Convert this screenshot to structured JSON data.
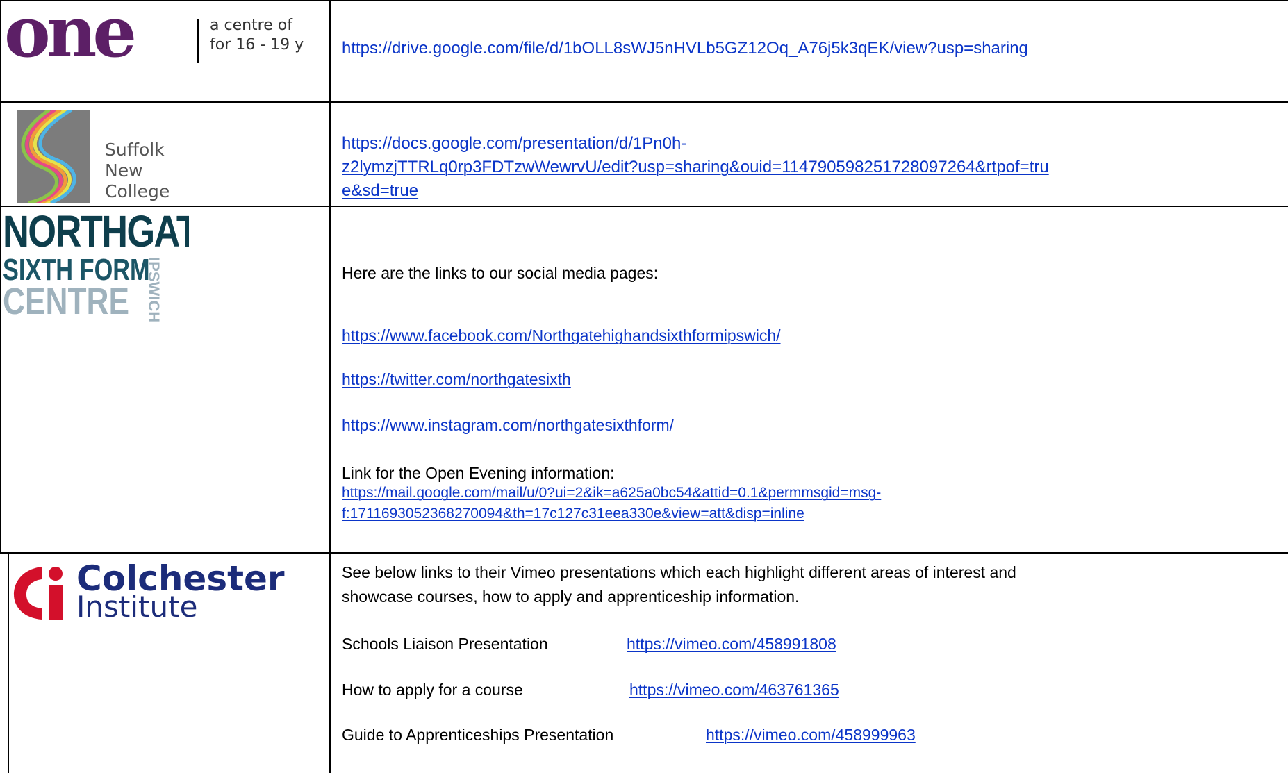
{
  "rows": [
    {
      "logo": {
        "name": "one",
        "wordmark": "one",
        "tagline_line1": "a centre of",
        "tagline_line2": "for 16 - 19 y",
        "color": "#5c1f66"
      },
      "url_lines": [
        "https://drive.google.com/file/d/1bOLL8sWJ5nHVLb5GZ12Oq_A76j5k3qEK/view?usp=sharing"
      ]
    },
    {
      "logo": {
        "name": "suffolk-new-college",
        "line1": "Suffolk",
        "line2": "New",
        "line3": "College"
      },
      "url_lines": [
        "https://docs.google.com/presentation/d/1Pn0h-",
        "z2lymzjTTRLq0rp3FDTzwWewrvU/edit?usp=sharing&ouid=114790598251728097264&rtpof=tru",
        "e&sd=true"
      ]
    },
    {
      "logo": {
        "name": "northgate-sixth-form-centre",
        "line1": "NORTHGATE",
        "line2": "SIXTH FORM",
        "line3": "CENTRE",
        "side": "IPSWICH",
        "color_dark": "#0e3e4c",
        "color_light": "#9fb2bd"
      },
      "intro": "Here are the links to our social media pages:",
      "social_links": [
        "https://www.facebook.com/Northgatehighandsixthformipswich/",
        "https://twitter.com/northgatesixth",
        "https://www.instagram.com/northgatesixthform/"
      ],
      "open_evening_label": "Link for the Open Evening information:",
      "open_evening_lines": [
        "https://mail.google.com/mail/u/0?ui=2&ik=a625a0bc54&attid=0.1&permmsgid=msg-",
        "f:1711693052368270094&th=17c127c31eea330e&view=att&disp=inline"
      ]
    },
    {
      "logo": {
        "name": "colchester-institute",
        "line1": "Colchester",
        "line2": "Institute",
        "red": "#d3102b",
        "blue": "#1c2c7a"
      },
      "intro_line1": "See below links to their Vimeo presentations which each highlight different areas of interest and",
      "intro_line2": "showcase courses, how to apply and apprenticeship information.",
      "presentations": [
        {
          "label": "Schools Liaison Presentation",
          "url": "https://vimeo.com/458991808"
        },
        {
          "label": "How to apply for a course",
          "url": "https://vimeo.com/463761365"
        },
        {
          "label": "Guide to Apprenticeships Presentation",
          "url": "https://vimeo.com/458999963"
        }
      ]
    }
  ],
  "colors": {
    "link": "#0b35c8",
    "border": "#000000"
  }
}
